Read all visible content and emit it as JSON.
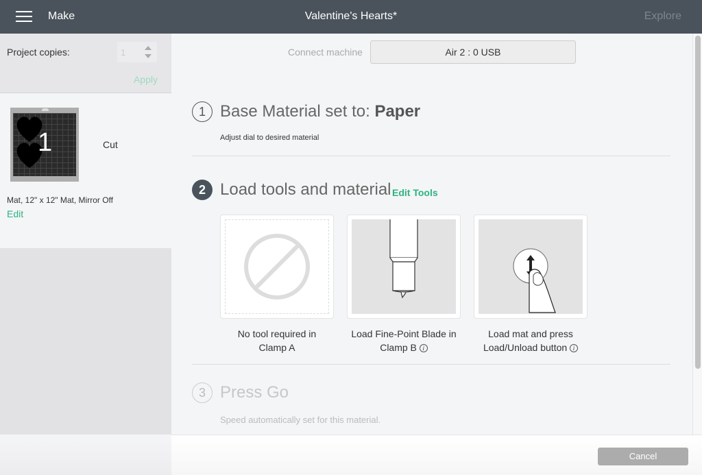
{
  "header": {
    "menu_icon": "hamburger-icon",
    "make_label": "Make",
    "title": "Valentine's Hearts*",
    "explore_label": "Explore"
  },
  "sidebar": {
    "copies_label": "Project copies:",
    "copies_value": "1",
    "apply_label": "Apply",
    "mat": {
      "number": "1",
      "action": "Cut",
      "description": "Mat, 12\" x 12\" Mat, Mirror Off",
      "edit_label": "Edit"
    }
  },
  "main": {
    "connect_label": "Connect machine",
    "machine_value": "Air 2 : 0 USB",
    "steps": [
      {
        "number": "1",
        "title_prefix": "Base Material set to: ",
        "title_value": "Paper",
        "subtitle": "Adjust dial to desired material"
      },
      {
        "number": "2",
        "title": "Load tools and material",
        "edit_tools_label": "Edit Tools",
        "tools": [
          {
            "icon": "no-tool-icon",
            "line1": "No tool required in",
            "line2": "Clamp A",
            "info": false
          },
          {
            "icon": "fine-point-blade-icon",
            "line1": "Load Fine-Point Blade in",
            "line2": "Clamp B",
            "info": true
          },
          {
            "icon": "load-unload-button-icon",
            "line1": "Load mat and press",
            "line2": "Load/Unload button",
            "info": true
          }
        ]
      },
      {
        "number": "3",
        "title": "Press Go",
        "subtitle": "Speed automatically set for this material."
      }
    ],
    "info_glyph": "i"
  },
  "footer": {
    "cancel_label": "Cancel"
  },
  "colors": {
    "header_bg": "#4a535c",
    "accent_green": "#2db37f",
    "apply_disabled": "#9fd9bf",
    "cancel_bg": "#acacac"
  }
}
